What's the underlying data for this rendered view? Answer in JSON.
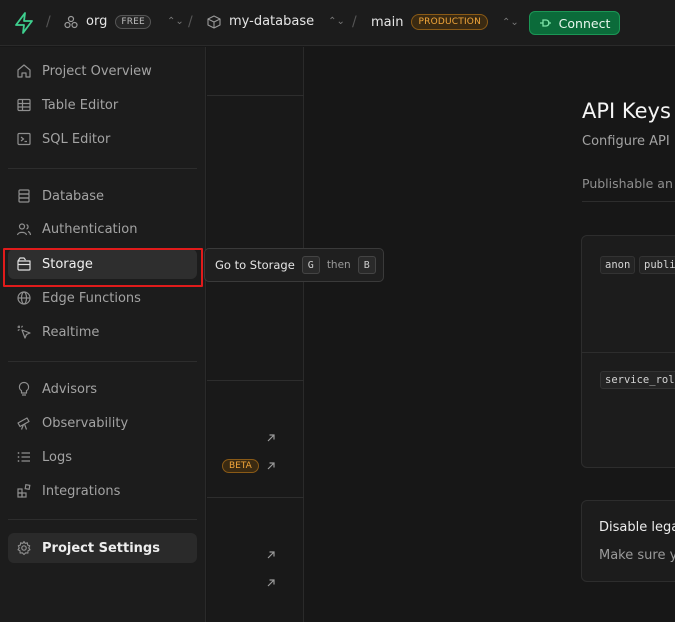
{
  "topbar": {
    "org_name": "org",
    "org_plan": "FREE",
    "project_name": "my-database",
    "branch_name": "main",
    "branch_env": "PRODUCTION",
    "connect_label": "Connect",
    "separator": "/",
    "chevron": "⌃⌄"
  },
  "sidebar": {
    "items": [
      {
        "label": "Project Overview",
        "icon": "home-icon"
      },
      {
        "label": "Table Editor",
        "icon": "table-icon"
      },
      {
        "label": "SQL Editor",
        "icon": "terminal-icon"
      },
      {
        "label": "Database",
        "icon": "database-icon"
      },
      {
        "label": "Authentication",
        "icon": "users-icon"
      },
      {
        "label": "Storage",
        "icon": "archive-icon"
      },
      {
        "label": "Edge Functions",
        "icon": "globe-icon"
      },
      {
        "label": "Realtime",
        "icon": "cursor-click-icon"
      },
      {
        "label": "Advisors",
        "icon": "lightbulb-icon"
      },
      {
        "label": "Observability",
        "icon": "telescope-icon"
      },
      {
        "label": "Logs",
        "icon": "list-icon"
      },
      {
        "label": "Integrations",
        "icon": "blocks-icon"
      },
      {
        "label": "Project Settings",
        "icon": "gear-icon"
      }
    ]
  },
  "tooltip": {
    "text": "Go to Storage",
    "key1": "G",
    "then": "then",
    "key2": "B"
  },
  "middle": {
    "beta_label": "BETA"
  },
  "main": {
    "title": "API Keys",
    "subtitle": "Configure API",
    "section_label": "Publishable an",
    "keys": [
      {
        "name": "anon",
        "tag": "publi"
      },
      {
        "name": "service_rol"
      }
    ],
    "legacy_title": "Disable lega",
    "legacy_desc": "Make sure y"
  },
  "colors": {
    "accent_green": "#0b6b3a",
    "production_orange": "#f2a63a",
    "highlight_red": "#e01b1b"
  }
}
